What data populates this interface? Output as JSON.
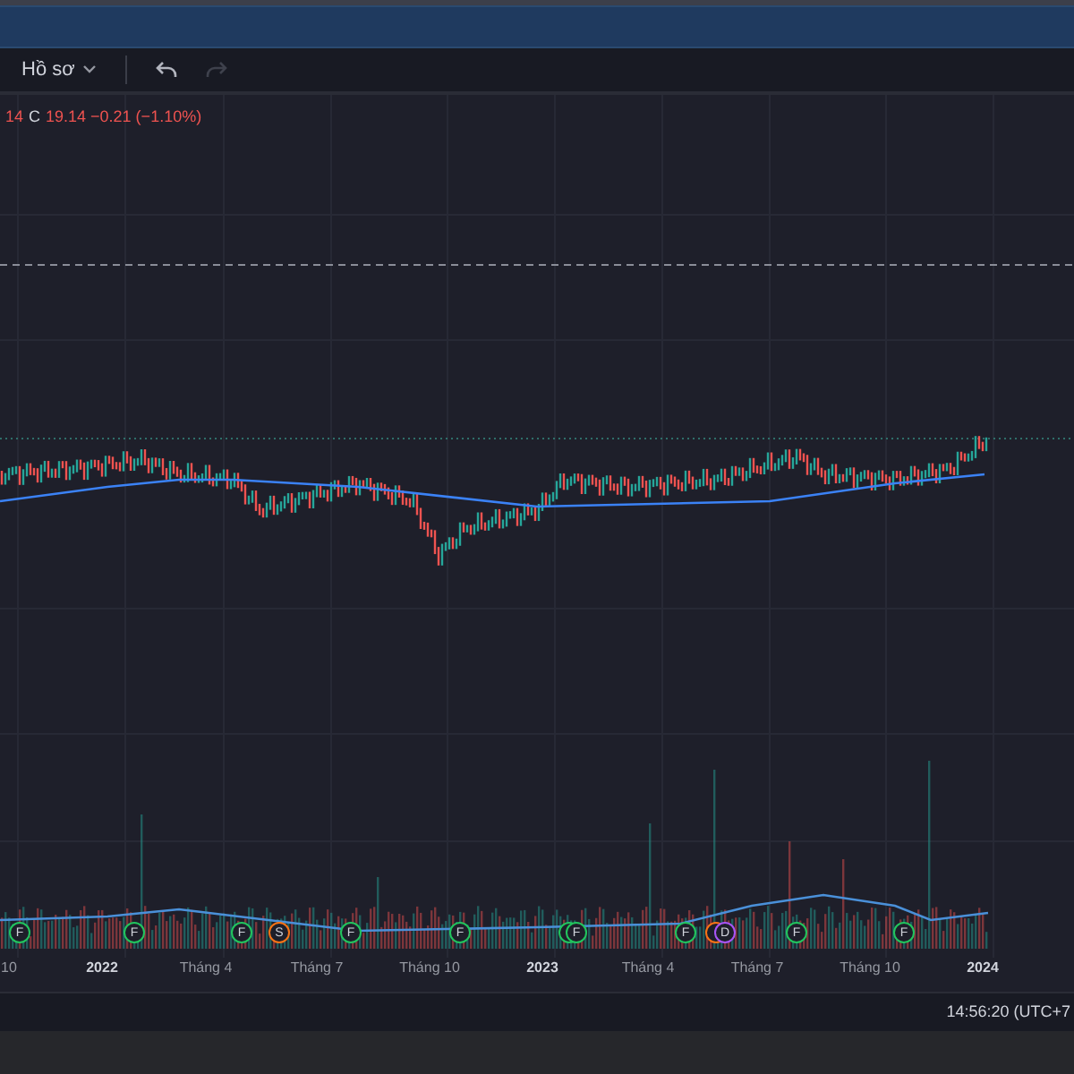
{
  "toolbar": {
    "profile_menu": {
      "label": "Hồ sơ"
    },
    "undo": {
      "disabled": false
    },
    "redo": {
      "disabled": true
    }
  },
  "legend": [
    {
      "text": "14",
      "kind": "value"
    },
    {
      "text": "C",
      "kind": "key"
    },
    {
      "text": "19.14 −0.21 (−1.10%)",
      "kind": "value"
    }
  ],
  "events": [
    {
      "kind": "earnings",
      "letter": "F"
    },
    {
      "kind": "earnings",
      "letter": "F"
    },
    {
      "kind": "earnings",
      "letter": "F"
    },
    {
      "kind": "split",
      "letter": "S"
    },
    {
      "kind": "earnings",
      "letter": "F"
    },
    {
      "kind": "earnings",
      "letter": "F"
    },
    {
      "kind": "earnings"
    },
    {
      "kind": "earnings",
      "letter": "F"
    },
    {
      "kind": "earnings",
      "letter": "F"
    },
    {
      "kind": "split"
    },
    {
      "kind": "dividend",
      "letter": "D"
    },
    {
      "kind": "earnings",
      "letter": "F"
    },
    {
      "kind": "earnings",
      "letter": "F"
    }
  ],
  "x_axis": {
    "labels": [
      "10",
      "2022",
      "Tháng 4",
      "Tháng 7",
      "Tháng 10",
      "2023",
      "Tháng 4",
      "Tháng 7",
      "Tháng 10",
      "2024"
    ]
  },
  "status_bar": {
    "time": "14:56:20 (UTC+7"
  }
}
